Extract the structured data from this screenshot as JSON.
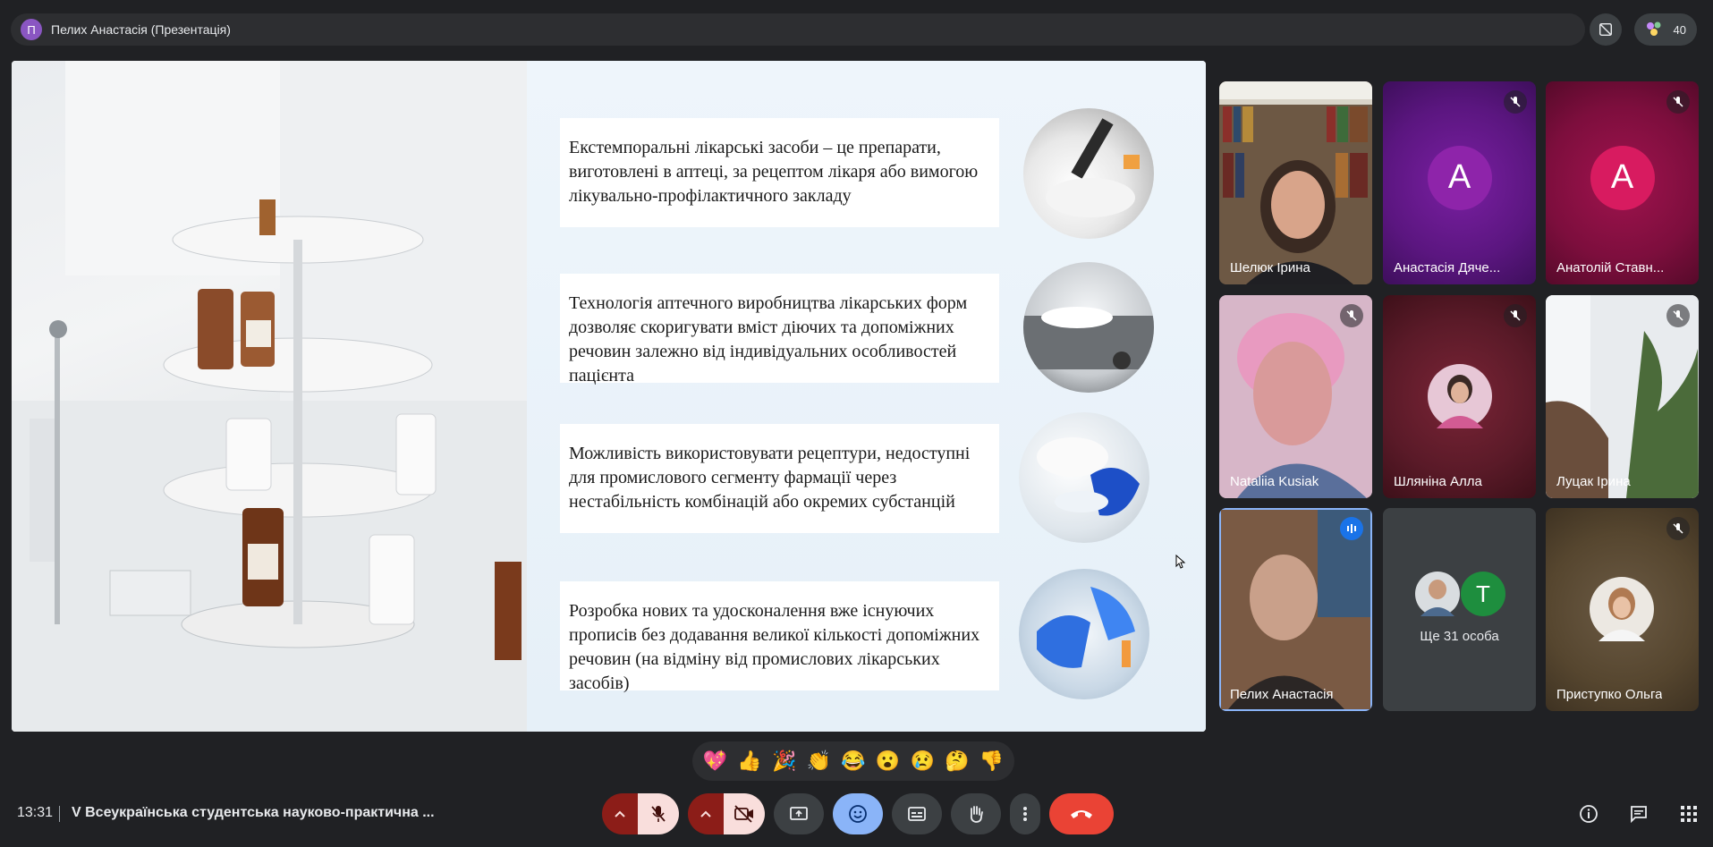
{
  "presenter_bar": {
    "initial": "П",
    "label": "Пелих Анастасія (Презентація)"
  },
  "top_right": {
    "participant_count": "40"
  },
  "slide": {
    "bullets": [
      "Екстемпоральні лікарські засоби – це препарати, виготовлені в  аптеці, за рецептом лікаря або вимогою лікувально-профілактичного закладу",
      "Технологія аптечного виробництва лікарських форм дозволяє скоригувати вміст діючих та допоміжних речовин залежно від індивідуальних особливостей пацієнта",
      "Можливість використовувати рецептури, недоступні для промислового сегменту фармації через нестабільність комбінацій або окремих субстанцій",
      "Розробка нових та удосконалення вже існуючих прописів без додавання великої кількості допоміжних речовин (на відміну від промислових лікарських засобів)"
    ]
  },
  "participants": [
    {
      "name": "Шелюк Ірина"
    },
    {
      "name": "Анастасія Дяче...",
      "initial": "А"
    },
    {
      "name": "Анатолій Ставн...",
      "initial": "А"
    },
    {
      "name": "Nataliia Kusiak"
    },
    {
      "name": "Шляніна Алла"
    },
    {
      "name": "Луцак Ірина"
    },
    {
      "name": "Пелих Анастасія"
    },
    {
      "name": "Ще 31 особа",
      "initial": "T"
    },
    {
      "name": "Приступко Ольга"
    }
  ],
  "reactions": [
    "💖",
    "👍",
    "🎉",
    "👏",
    "😂",
    "😮",
    "😢",
    "🤔",
    "👎"
  ],
  "bottom": {
    "time": "13:31",
    "meeting_title": "V Всеукраїнська студентська науково-практична ..."
  },
  "colors": {
    "end_call": "#ea4335",
    "active_blue": "#8ab4f8",
    "muted_bg": "#f9dedc"
  }
}
